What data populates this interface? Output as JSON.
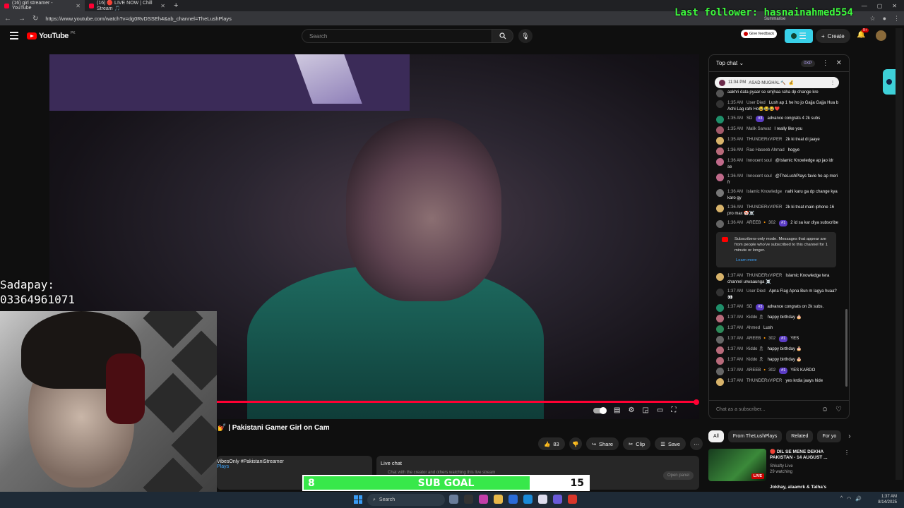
{
  "browser": {
    "tabs": [
      {
        "label": "(16) girl streamer - YouTube",
        "active": true
      },
      {
        "label": "(16) 🔴 LIVE NOW | Chill Stream 🎵",
        "active": false
      }
    ],
    "url": "https://www.youtube.com/watch?v=dg0RvDSSEh4&ab_channel=TheLushPlays"
  },
  "overlays": {
    "last_follower": "Last follower: hasnainahmed554",
    "sadapay_label": "Sadapay:",
    "sadapay_number": "03364961071",
    "sub_goal": {
      "current": "8",
      "label": "SUB GOAL",
      "target": "15",
      "progress_fraction": 0.53
    }
  },
  "header": {
    "logo_text": "YouTube",
    "country_code": "PK",
    "search_placeholder": "Search",
    "feedback_label": "Give feedback",
    "summarise_label": "Summarise",
    "create_label": "Create",
    "notif_badge": "9+"
  },
  "video": {
    "title": "💅 | Pakistani Gamer Girl on Cam",
    "likes": "83",
    "share_label": "Share",
    "clip_label": "Clip",
    "save_label": "Save",
    "desc_hashtags": "VibesOnly #PakistaniStreamer",
    "desc_channel": "Plays",
    "live_chat_label": "Live chat",
    "live_chat_sub": "Chat with the creator and others watching this live stream",
    "open_panel_label": "Open panel"
  },
  "chat": {
    "header": "Top chat",
    "xp_label": "0XP",
    "pinned": {
      "time": "11:04 PM",
      "name": "ASAD MUGHAL 🔨",
      "emoji": "💰"
    },
    "messages": [
      {
        "time": "",
        "name": "",
        "badge": "",
        "text": "aakhri data pyaar se smjhaa raha dp change kre",
        "color": "#555"
      },
      {
        "time": "1:35 AM",
        "name": "User Died",
        "badge": "",
        "text": "Lush ap 1 he ho jo Gajja Gajja Hua b Achi Lag rahi Ho😂😂😂❤️",
        "color": "#333"
      },
      {
        "time": "1:35 AM",
        "name": "SD",
        "badge": "#3",
        "text": "advance congrats 4 2k subs",
        "color": "#1f8f6a"
      },
      {
        "time": "1:35 AM",
        "name": "Malik Sarwat",
        "badge": "",
        "text": "I really like you",
        "color": "#a25a6a"
      },
      {
        "time": "1:35 AM",
        "name": "THUNDERxVIPER",
        "badge": "",
        "text": "2k ki treat di jaaye",
        "color": "#d8b36a"
      },
      {
        "time": "1:36 AM",
        "name": "Rao Haseeb Ahmad",
        "badge": "",
        "text": "hogye",
        "color": "#b86a7a"
      },
      {
        "time": "1:36 AM",
        "name": "Innocent soul",
        "badge": "",
        "text": "@Islamic Knowledge ap jao idr se",
        "color": "#c06a8a"
      },
      {
        "time": "1:36 AM",
        "name": "Innocent soul",
        "badge": "",
        "text": "@TheLushPlays favie ho ap meri fr",
        "color": "#c06a8a"
      },
      {
        "time": "1:36 AM",
        "name": "Islamic Knowledge",
        "badge": "",
        "text": "nahi karu ga dp change kya karo gy",
        "color": "#777"
      },
      {
        "time": "1:36 AM",
        "name": "THUNDERxVIPER",
        "badge": "",
        "text": "2k ki treat main iphone 16 pro max 🤡☠️",
        "color": "#d8b36a"
      },
      {
        "time": "1:36 AM",
        "name": "AREEB 🔸 302",
        "badge": "#1",
        "text": "2 id sa kar diya subscribe",
        "color": "#666"
      }
    ],
    "notice": {
      "text": "Subscribers-only mode. Messages that appear are from people who've subscribed to this channel for 1 minute or longer.",
      "learn_more": "Learn more"
    },
    "messages2": [
      {
        "time": "1:37 AM",
        "name": "THUNDERxVIPER",
        "badge": "",
        "text": "Islamic Knowledge tera channel urwaaunga ☠️",
        "color": "#d8b36a"
      },
      {
        "time": "1:37 AM",
        "name": "User Died",
        "badge": "",
        "text": "Apna Flag Apna Bun m lagya huaa?👀",
        "color": "#333"
      },
      {
        "time": "1:37 AM",
        "name": "SD",
        "badge": "#3",
        "text": "advance congrats on 2k subs.",
        "color": "#1f8f6a"
      },
      {
        "time": "1:37 AM",
        "name": "Kiddo 🎗",
        "badge": "",
        "text": "happy birthday 🎂",
        "color": "#b86a7a"
      },
      {
        "time": "1:37 AM",
        "name": "Ahmed",
        "badge": "",
        "text": "Lush",
        "color": "#2d8a5a"
      },
      {
        "time": "1:37 AM",
        "name": "AREEB 🔸 302",
        "badge": "#1",
        "text": "YES",
        "color": "#666"
      },
      {
        "time": "1:37 AM",
        "name": "Kiddo 🎗",
        "badge": "",
        "text": "happy birthday 🎂",
        "color": "#b86a7a"
      },
      {
        "time": "1:37 AM",
        "name": "Kiddo 🎗",
        "badge": "",
        "text": "happy birthday 🎂",
        "color": "#b86a7a"
      },
      {
        "time": "1:37 AM",
        "name": "AREEB 🔸 302",
        "badge": "#1",
        "text": "YES KARDO",
        "color": "#666"
      },
      {
        "time": "1:37 AM",
        "name": "THUNDERxVIPER",
        "badge": "",
        "text": "yes krdia jaays hide",
        "color": "#d8b36a"
      }
    ],
    "input_placeholder": "Chat as a subscriber..."
  },
  "chips": [
    "All",
    "From TheLushPlays",
    "Related",
    "For yo"
  ],
  "recommendations": [
    {
      "title": "🔴 DIL SE MENE DEKHA PAKISTAN - 14 AUGUST ...",
      "channel": "Shkafty Live",
      "meta": "29 watching",
      "live_label": "LIVE"
    },
    {
      "title": "Jokhay, alaamrk & Talha's"
    }
  ],
  "taskbar": {
    "search_label": "Search",
    "time": "1:37 AM",
    "date": "8/14/2025"
  }
}
